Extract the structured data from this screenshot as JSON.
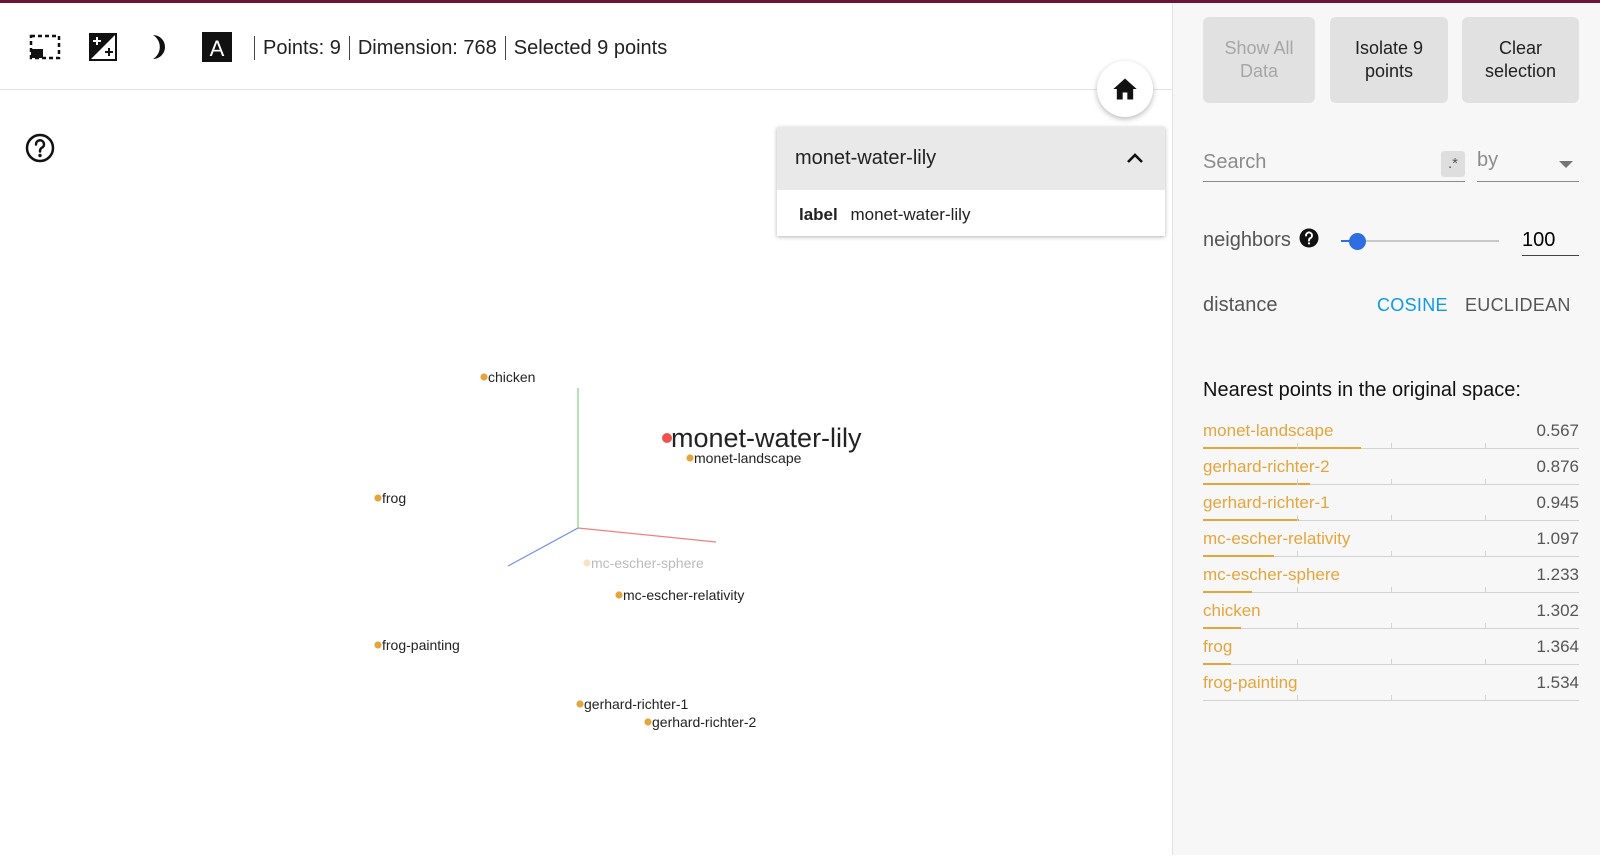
{
  "toolbar": {
    "icons": [
      {
        "name": "rect-select-icon"
      },
      {
        "name": "night-mode-icon"
      },
      {
        "name": "crescent-icon"
      },
      {
        "name": "label-toggle-icon"
      }
    ],
    "points": "Points: 9",
    "dimension": "Dimension: 768",
    "selected": "Selected 9 points"
  },
  "inspector": {
    "title": "monet-water-lily",
    "field_key": "label",
    "field_value": "monet-water-lily"
  },
  "scatter": {
    "selected_color": "#ef5350",
    "point_color": "#e4a63c",
    "points": [
      {
        "label": "chicken",
        "faded": false
      },
      {
        "label": "monet-water-lily",
        "selected": true
      },
      {
        "label": "monet-landscape",
        "faded": false
      },
      {
        "label": "frog",
        "faded": false
      },
      {
        "label": "mc-escher-sphere",
        "faded": true
      },
      {
        "label": "mc-escher-relativity",
        "faded": false
      },
      {
        "label": "frog-painting",
        "faded": false
      },
      {
        "label": "gerhard-richter-1",
        "faded": false
      },
      {
        "label": "gerhard-richter-2",
        "faded": false
      }
    ]
  },
  "panel": {
    "show_all": "Show All\nData",
    "isolate": "Isolate 9\npoints",
    "clear": "Clear\nselection",
    "search_placeholder": "Search",
    "regex": ".*",
    "by": "by",
    "neighbors_label": "neighbors",
    "neighbors_value": "100",
    "neighbors_fraction": 0.1,
    "distance_label": "distance",
    "cosine": "COSINE",
    "euclidean": "EUCLIDEAN",
    "nearest_title": "Nearest points in the original space:",
    "accent": "#e4a63c",
    "nearest": [
      {
        "name": "monet-landscape",
        "value": "0.567"
      },
      {
        "name": "gerhard-richter-2",
        "value": "0.876"
      },
      {
        "name": "gerhard-richter-1",
        "value": "0.945"
      },
      {
        "name": "mc-escher-relativity",
        "value": "1.097"
      },
      {
        "name": "mc-escher-sphere",
        "value": "1.233"
      },
      {
        "name": "chicken",
        "value": "1.302"
      },
      {
        "name": "frog",
        "value": "1.364"
      },
      {
        "name": "frog-painting",
        "value": "1.534"
      }
    ]
  }
}
